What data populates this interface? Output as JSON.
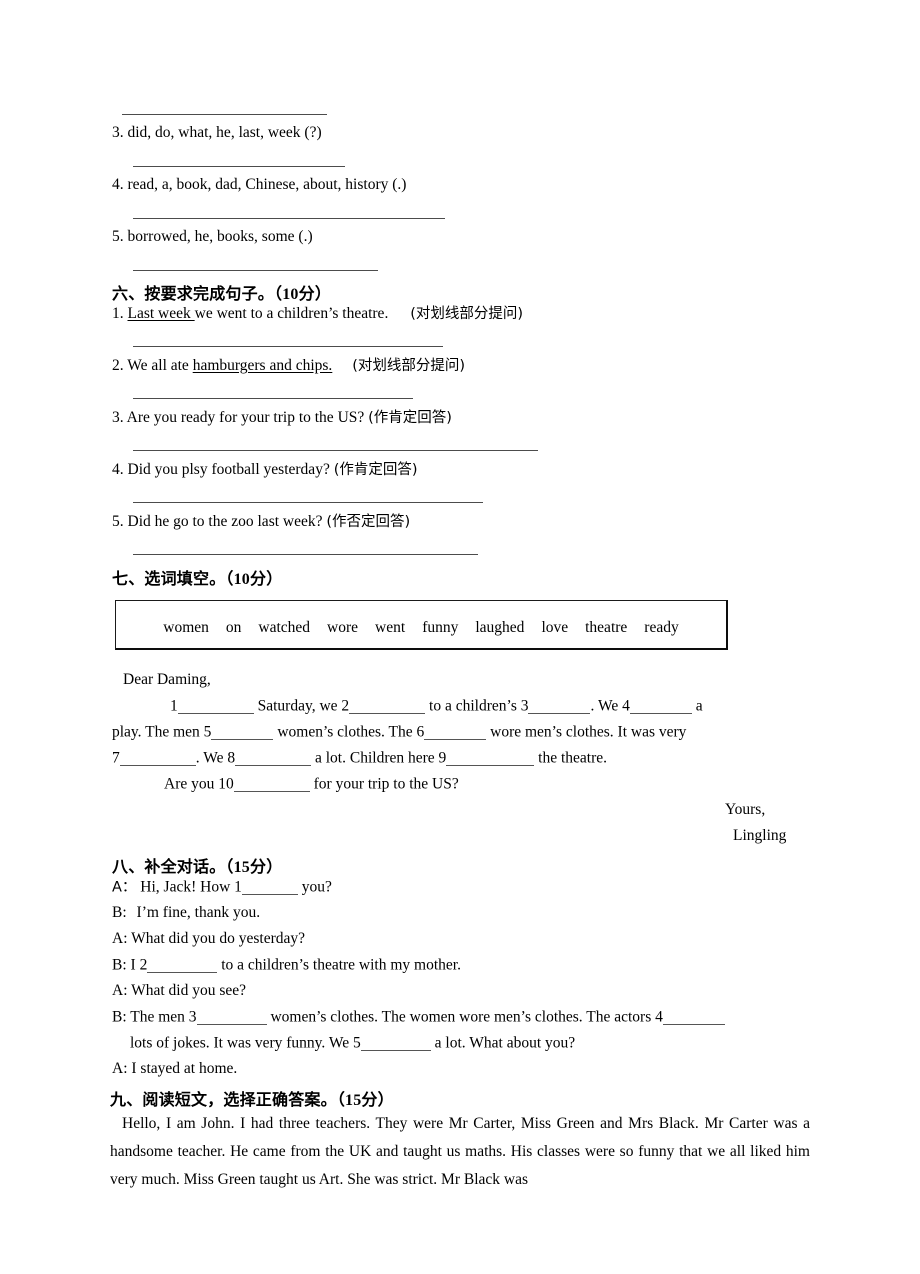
{
  "document": {
    "type": "english-exam-worksheet-page",
    "language": "zh-CN + en"
  },
  "section_five_tail": {
    "items": [
      {
        "num": "3.",
        "text": "did, do, what, he, last, week (?)"
      },
      {
        "num": "4.",
        "text": "read, a, book, dad, Chinese, about, history (.)"
      },
      {
        "num": "5.",
        "text": "borrowed, he, books, some (.)"
      }
    ]
  },
  "section_six": {
    "heading": "六、按要求完成句子。（10分）",
    "heading_label": "六、按要求完成句子。",
    "heading_points": "（10分）",
    "items": [
      {
        "num": "1.",
        "underlined": "Last week ",
        "rest": "we went to a children’s theatre.",
        "instruction": "(对划线部分提问)"
      },
      {
        "num": "2.",
        "pre": "We all ate ",
        "underlined": "hamburgers and chips.",
        "instruction": "(对划线部分提问)"
      },
      {
        "num": "3.",
        "text": "Are you ready for your trip to the US?",
        "instruction": "(作肯定回答)"
      },
      {
        "num": "4.",
        "text": "Did you plsy football yesterday?",
        "instruction": "(作肯定回答)"
      },
      {
        "num": "5.",
        "text": "Did he go to the zoo last week?",
        "instruction": "(作否定回答)"
      }
    ]
  },
  "section_seven": {
    "heading": "七、选词填空。（10分）",
    "heading_label": "七、选词填空。",
    "heading_points": "（10分）",
    "word_bank": [
      "women",
      "on",
      "watched",
      "wore",
      "went",
      "funny",
      "laughed",
      "love",
      "theatre",
      "ready"
    ],
    "letter": {
      "salutation": "Dear Daming,",
      "line1_a": "1",
      "line1_b": "Saturday, we 2",
      "line1_c": "to a children’s 3",
      "line1_d": ". We 4",
      "line1_e": "a",
      "line2_a": "play. The men 5",
      "line2_b": "women’s clothes. The 6",
      "line2_c": "wore men’s clothes. It was very",
      "line3_a": "7",
      "line3_b": ". We 8",
      "line3_c": "a lot. Children here 9",
      "line3_d": "the theatre.",
      "line4_a": "Are you 10",
      "line4_b": "for your trip to the US?",
      "sign_off": "Yours,",
      "signature": "Lingling"
    }
  },
  "section_eight": {
    "heading": "八、补全对话。（15分）",
    "heading_label": "八、补全对话。",
    "heading_points": "（15分）",
    "lines": {
      "l1_speaker": "A：",
      "l1_a": "Hi, Jack! How 1",
      "l1_b": "you?",
      "l2_speaker": "B:",
      "l2_text": "I’m fine, thank you.",
      "l3_speaker": "A:",
      "l3_text": "What did you do yesterday?",
      "l4_speaker": "B:",
      "l4_a": "I 2",
      "l4_b": "to a children’s theatre with my mother.",
      "l5_speaker": "A:",
      "l5_text": "What did you see?",
      "l6_speaker": "B:",
      "l6_a": "The men 3",
      "l6_b": "women’s clothes. The women wore men’s clothes. The actors 4",
      "l7_a": "lots of jokes. It was very funny. We 5",
      "l7_b": "a lot. What about you?",
      "l8_speaker": "A:",
      "l8_text": "I stayed at home."
    }
  },
  "section_nine": {
    "heading": "九、阅读短文，选择正确答案。（15分）",
    "heading_label": "九、阅读短文，选择正确答案。",
    "heading_points": "（15分）",
    "passage": "Hello, I am John. I had three teachers. They were Mr Carter, Miss Green and Mrs Black. Mr Carter was a handsome teacher. He came from the UK and taught us maths. His classes were so funny that we all liked him very much. Miss Green taught us Art. She was strict. Mr Black was"
  }
}
